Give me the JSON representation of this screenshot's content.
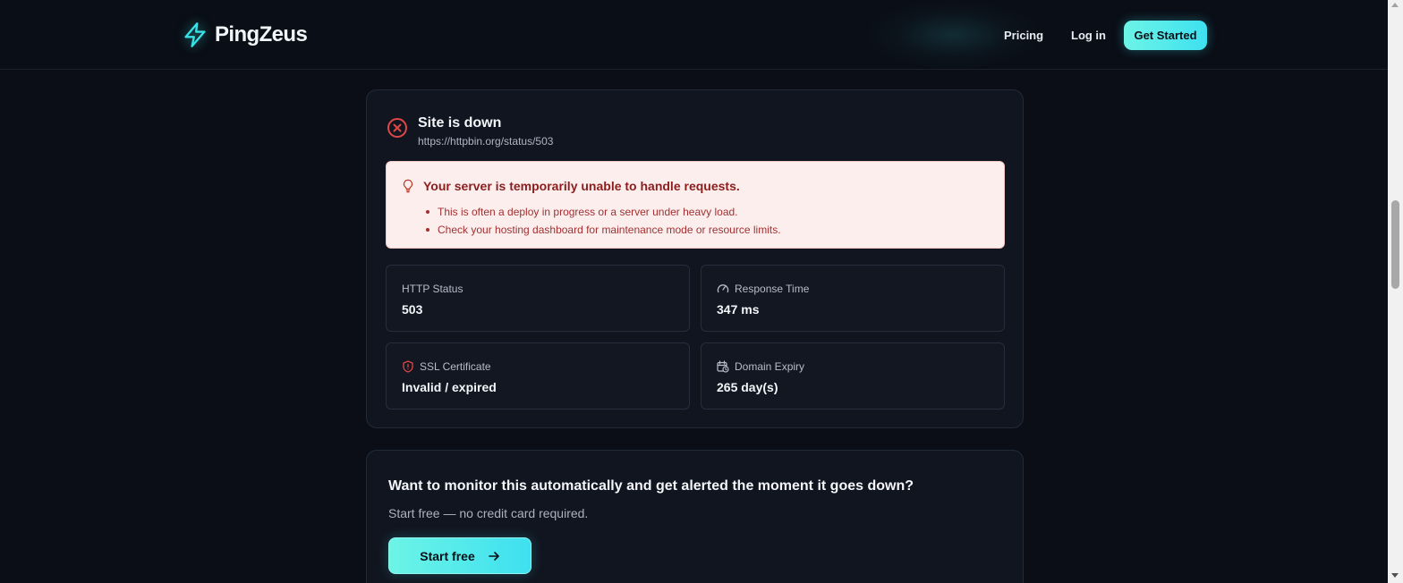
{
  "header": {
    "brand": "PingZeus",
    "brand_icon": "lightning-bolt-icon",
    "nav": {
      "pricing": "Pricing",
      "login": "Log in"
    },
    "cta": "Get Started"
  },
  "result": {
    "status_title": "Site is down",
    "status_icon": "x-circle-icon",
    "url": "https://httpbin.org/status/503",
    "alert": {
      "icon": "lightbulb-icon",
      "title": "Your server is temporarily unable to handle requests.",
      "tips": [
        "This is often a deploy in progress or a server under heavy load.",
        "Check your hosting dashboard for maintenance mode or resource limits."
      ]
    },
    "stats": [
      {
        "label": "HTTP Status",
        "value": "503",
        "icon": ""
      },
      {
        "label": "Response Time",
        "value": "347 ms",
        "icon": "gauge-icon"
      },
      {
        "label": "SSL Certificate",
        "value": "Invalid / expired",
        "icon": "shield-alert-icon"
      },
      {
        "label": "Domain Expiry",
        "value": "265 day(s)",
        "icon": "calendar-clock-icon"
      }
    ]
  },
  "cta_card": {
    "title": "Want to monitor this automatically and get alerted the moment it goes down?",
    "subtitle": "Start free — no credit card required.",
    "button": "Start free",
    "button_icon": "arrow-right-icon"
  },
  "colors": {
    "accent": "#3ee0f0",
    "danger": "#e04848",
    "background": "#0b0e17",
    "card": "#11151f",
    "alert_bg": "#fdeeee"
  }
}
